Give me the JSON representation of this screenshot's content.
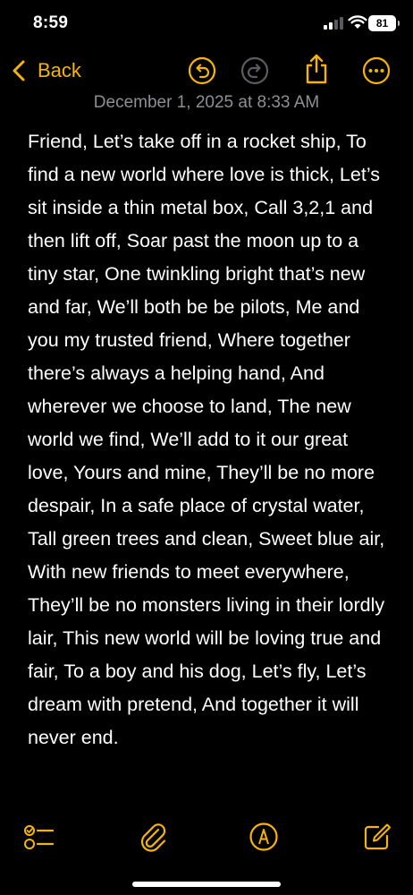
{
  "status_bar": {
    "time": "8:59",
    "battery": "81"
  },
  "nav": {
    "back_label": "Back",
    "accent_color": "#f5b40a",
    "icons": [
      "undo-icon",
      "redo-icon",
      "share-icon",
      "more-icon"
    ]
  },
  "note": {
    "date": "December 1, 2025 at 8:33 AM",
    "body": "Friend, Let’s take off in a rocket ship, To find a new world where love is thick, Let’s sit inside a thin metal box, Call 3,2,1 and then lift off, Soar past the moon up to a tiny star, One twinkling bright that’s new and far, We’ll both be be pilots, Me and you my trusted friend, Where together there’s always a helping hand, And wherever we choose to land, The new world we find, We’ll add to it our great love, Yours and mine, They’ll be no more despair, In a safe place of crystal water, Tall green trees and clean, Sweet blue air, With new friends to meet everywhere, They’ll be no monsters living in their lordly lair, This new world will be loving true and fair, To a boy and his dog, Let’s fly, Let’s dream with pretend, And together it will never end."
  },
  "toolbar": {
    "icons": [
      "checklist-icon",
      "paperclip-icon",
      "markup-icon",
      "compose-icon"
    ]
  }
}
